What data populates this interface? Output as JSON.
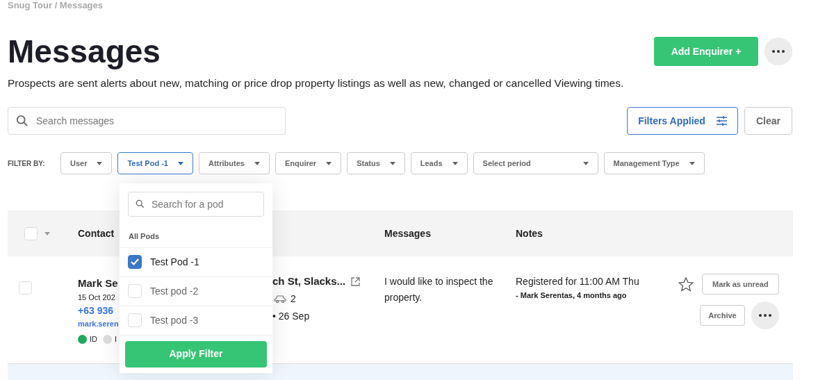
{
  "breadcrumb": "Snug Tour / Messages",
  "title": "Messages",
  "description": "Prospects are sent alerts about new, matching or price drop property listings as well as new, changed or cancelled Viewing times.",
  "add_button": "Add Enquirer +",
  "search": {
    "placeholder": "Search messages"
  },
  "filters_applied_button": "Filters Applied",
  "clear_button": "Clear",
  "filter_label": "FILTER BY:",
  "filters": [
    {
      "label": "User",
      "active": false,
      "wide": false
    },
    {
      "label": "Test Pod -1",
      "active": true,
      "wide": false
    },
    {
      "label": "Attributes",
      "active": false,
      "wide": false
    },
    {
      "label": "Enquirer",
      "active": false,
      "wide": false
    },
    {
      "label": "Status",
      "active": false,
      "wide": false
    },
    {
      "label": "Leads",
      "active": false,
      "wide": false
    },
    {
      "label": "Select period",
      "active": false,
      "wide": true
    },
    {
      "label": "Management Type",
      "active": false,
      "wide": false
    }
  ],
  "pod_dropdown": {
    "search_placeholder": "Search for a pod",
    "group_label": "All Pods",
    "options": [
      {
        "label": "Test Pod -1",
        "checked": true
      },
      {
        "label": "Test pod -2",
        "checked": false
      },
      {
        "label": "Test pod -3",
        "checked": false
      }
    ],
    "apply_button": "Apply Filter"
  },
  "table": {
    "select_all_checked": false,
    "columns": [
      "Contact",
      "Messages",
      "Notes"
    ],
    "rows": [
      {
        "checked": false,
        "name": "Mark Se",
        "date": "15 Oct 202",
        "phone": "+63 936",
        "email": "mark.seren",
        "badges": [
          {
            "label": "ID",
            "color": "#1fa95b"
          },
          {
            "label": "I",
            "color": "#dddddd"
          }
        ],
        "address": "ch St, Slacks...",
        "cars": "2",
        "inspection": "• 26 Sep",
        "message": "I would like to inspect the property.",
        "note": "Registered for 11:00 AM Thu",
        "note_author": "- Mark Serentas, 4 months ago",
        "starred": false,
        "actions": [
          "Mark as unread",
          "Archive"
        ]
      }
    ]
  }
}
